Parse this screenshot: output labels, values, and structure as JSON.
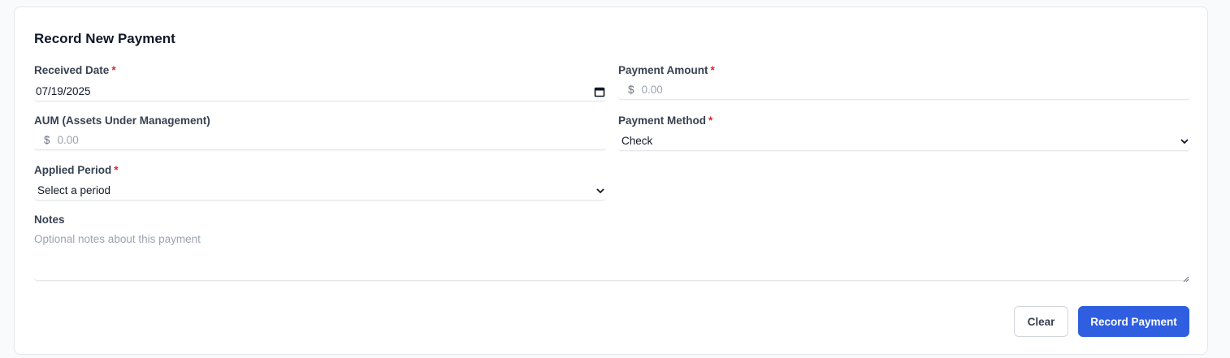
{
  "form": {
    "title": "Record New Payment",
    "required_marker": "*",
    "received_date": {
      "label": "Received Date",
      "value": "07/19/2025"
    },
    "payment_amount": {
      "label": "Payment Amount",
      "prefix": "$",
      "placeholder": "0.00"
    },
    "aum": {
      "label": "AUM (Assets Under Management)",
      "prefix": "$",
      "placeholder": "0.00"
    },
    "payment_method": {
      "label": "Payment Method",
      "value": "Check"
    },
    "applied_period": {
      "label": "Applied Period",
      "value": "Select a period"
    },
    "notes": {
      "label": "Notes",
      "placeholder": "Optional notes about this payment"
    }
  },
  "actions": {
    "clear_label": "Clear",
    "submit_label": "Record Payment"
  },
  "colors": {
    "primary": "#2f5ee0",
    "required": "#dc2626",
    "background": "#f8fafc"
  },
  "icons": {
    "date": "calendar-icon",
    "select": "chevron-down-icon"
  }
}
